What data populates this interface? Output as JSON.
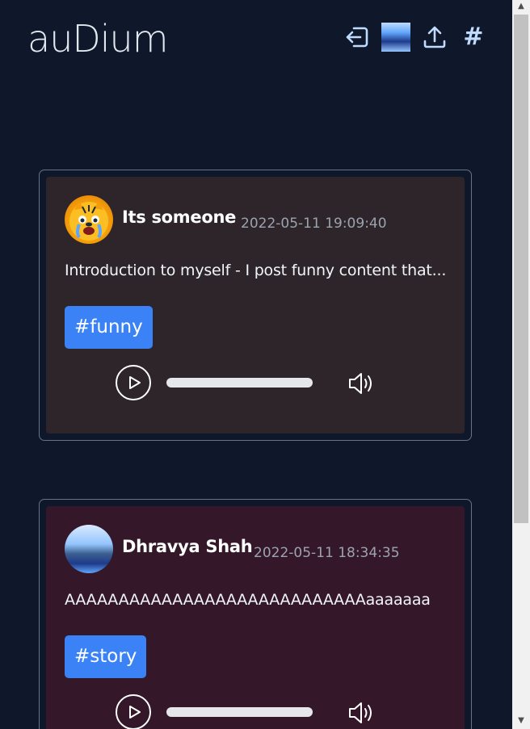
{
  "app": {
    "title": "auDium"
  },
  "header": {
    "icons": [
      "logout-icon",
      "profile-avatar",
      "upload-icon",
      "hashtag-icon"
    ],
    "hashtag_symbol": "#"
  },
  "posts": [
    {
      "username": "Its someone",
      "timestamp": "2022-05-11 19:09:40",
      "content": "Introduction to myself - I post funny content that...",
      "tag": "#funny",
      "avatar": "tiger-emoji",
      "progress": 0
    },
    {
      "username": "Dhravya Shah",
      "timestamp": "2022-05-11 18:34:35",
      "content": "AAAAAAAAAAAAAAAAAAAAAAAAAAAAaaaaaaa",
      "tag": "#story",
      "avatar": "landscape-photo",
      "progress": 0
    }
  ],
  "colors": {
    "background": "#0f172a",
    "accent": "#3b82f6",
    "post1_bg": "#2d2529",
    "post2_bg": "#34182a",
    "nav_icon": "#bfdbfe"
  },
  "player_icons": [
    "play-icon",
    "volume-icon"
  ]
}
